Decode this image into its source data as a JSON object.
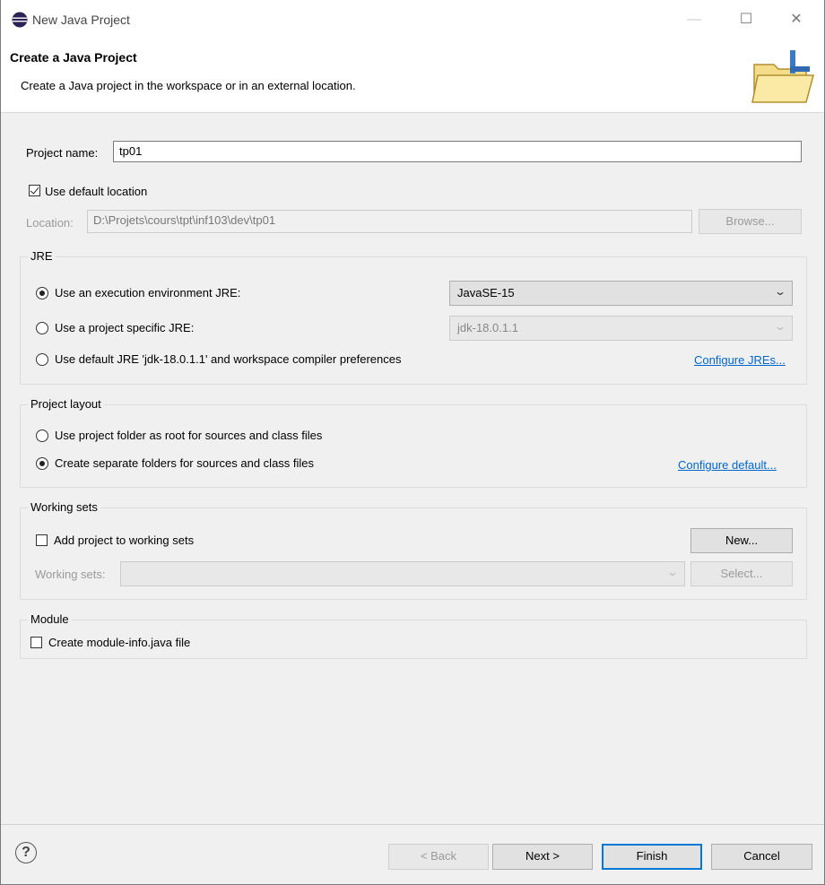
{
  "window": {
    "title": "New Java Project"
  },
  "banner": {
    "heading": "Create a Java Project",
    "description": "Create a Java project in the workspace or in an external location."
  },
  "project": {
    "name_label": "Project name:",
    "name_value": "tp01",
    "default_location_label": "Use default location",
    "default_location_checked": true,
    "location_label": "Location:",
    "location_value": "D:\\Projets\\cours\\tpt\\inf103\\dev\\tp01",
    "browse_label": "Browse..."
  },
  "jre": {
    "group_title": "JRE",
    "opt_execution_env": "Use an execution environment JRE:",
    "execution_env_value": "JavaSE-15",
    "opt_project_specific": "Use a project specific JRE:",
    "project_specific_value": "jdk-18.0.1.1",
    "opt_default": "Use default JRE 'jdk-18.0.1.1' and workspace compiler preferences",
    "configure_link": "Configure JREs..."
  },
  "layout": {
    "group_title": "Project layout",
    "opt_root": "Use project folder as root for sources and class files",
    "opt_separate": "Create separate folders for sources and class files",
    "configure_link": "Configure default..."
  },
  "working_sets": {
    "group_title": "Working sets",
    "add_label": "Add project to working sets",
    "new_button": "New...",
    "sets_label": "Working sets:",
    "select_button": "Select..."
  },
  "module": {
    "group_title": "Module",
    "create_label": "Create module-info.java file"
  },
  "footer": {
    "help": "?",
    "back": "< Back",
    "next": "Next >",
    "finish": "Finish",
    "cancel": "Cancel"
  }
}
